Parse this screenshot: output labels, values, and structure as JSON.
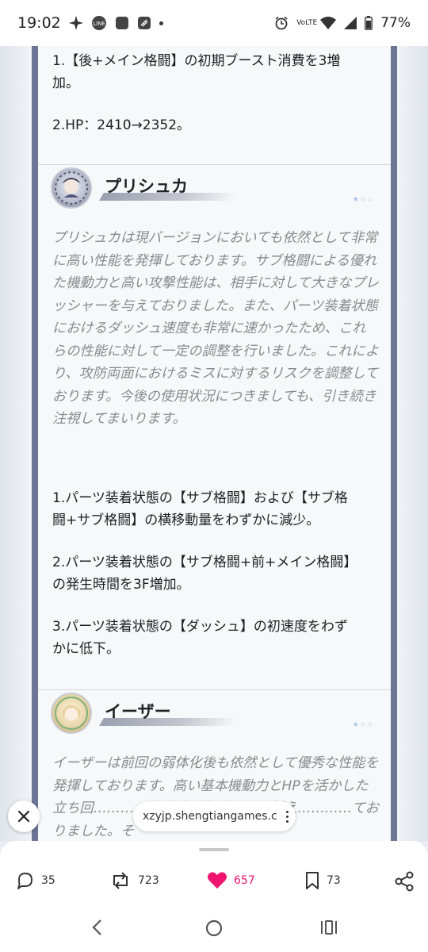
{
  "status_bar": {
    "time": "19:02",
    "network": "VoLTE",
    "battery": "77%",
    "icons": [
      "sparkle-icon",
      "line-app-icon",
      "square-app-icon",
      "shield-app-icon",
      "dot",
      "alarm-icon",
      "wifi-icon",
      "signal-icon",
      "battery-icon"
    ]
  },
  "article": {
    "prev_section": {
      "item1": "1.【後+メイン格闘】の初期ブースト消費を3増\n加。",
      "item2": "2.HP：2410→2352。"
    },
    "characters": [
      {
        "name": "プリシュカ",
        "stars": "★☆☆",
        "summary": "プリシュカは現バージョンにおいても依然として非常に高い性能を発揮しております。サブ格闘による優れた機動力と高い攻撃性能は、相手に対して大きなプレッシャーを与えておりました。また、パーツ装着状態におけるダッシュ速度も非常に速かったため、これらの性能に対して一定の調整を行いました。これにより、攻防両面におけるミスに対するリスクを調整しております。今後の使用状況につきましても、引き続き注視してまいります。",
        "changes": [
          "1.パーツ装着状態の【サブ格闘】および【サブ格\n闘+サブ格闘】の横移動量をわずかに減少。",
          "2.パーツ装着状態の【サブ格闘+前+メイン格闘】\nの発生時間を3F増加。",
          "3.パーツ装着状態の【ダッシュ】の初速度をわず\nかに低下。"
        ]
      },
      {
        "name": "イーザー",
        "stars": "★☆☆",
        "summary": "イーザーは前回の弱体化後も依然として優秀な性能を発揮しております。高い基本機動力とHPを活かした立ち回…………許容度と相手からの捉え…………ておりました。そ"
      }
    ]
  },
  "url_bar": {
    "url": "xzyjp.shengtiangames.c..."
  },
  "actions": {
    "replies": "35",
    "reposts": "723",
    "likes": "657",
    "bookmarks": "73"
  },
  "colors": {
    "accent_like": "#f0136f",
    "frame": "#6d7594",
    "summary_text": "#8a8a8a"
  }
}
